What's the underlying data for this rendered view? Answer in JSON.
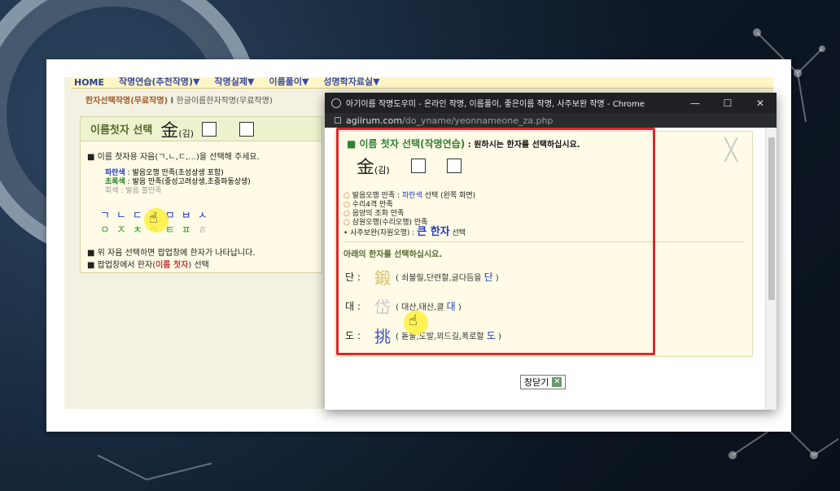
{
  "colors": {
    "accent_red": "#e0262b",
    "green": "#2f7f2f",
    "blue": "#1f3bbf"
  },
  "page": {
    "topnav": [
      "HOME",
      "작명연습(추천작명)▼",
      "작명실제▼",
      "이름풀이▼",
      "성명학자료실▼"
    ],
    "tabs": {
      "t1": "한자선택작명(무료작명)",
      "sep": " l ",
      "t2": "한글이름한자작명(무료작명)"
    },
    "left": {
      "title": "이름첫자 선택",
      "hanja": "金",
      "kim": "(김)",
      "instr": "■ 이름 첫자용 자음(ㄱ,ㄴ,ㄷ,...)을 선택해 주세요.",
      "legend": [
        {
          "c": "파란색",
          "t": " : 발음오행 만족(초성상생 포함)"
        },
        {
          "c": "초록색",
          "t": " : 발음 만족(중성고려상생,초중파동상생)"
        },
        {
          "c": "회색",
          "t": " : 발음 불만족"
        }
      ],
      "row1": "ㄱㄴㄷㄹㅁㅂㅅ",
      "row2_green": "ㅇㅈㅊㅋㅌㅍ",
      "row2_gray": "ㅎ",
      "note1": "■ 위 자음 선택하면 팝업창에 한자가 나타납니다.",
      "note2_a": "■ 팝업창에서 한자(",
      "note2_b": "이름 첫자",
      "note2_c": ") 선택"
    }
  },
  "popup": {
    "window_title": "아기이름 작명도우미 - 온라인 작명, 이름풀이, 좋은이름 작명, 사주보완 작명 - Chrome",
    "controls": [
      "—",
      "☐",
      "✕"
    ],
    "url_host": "agiirum.com",
    "url_path": "/do_yname/yeonnameone_za.php",
    "title_main": "■ 이름 첫자 선택(작명연습)",
    "title_sub": " : 원하시는 한자를 선택하십시요.",
    "name_hanja": "金",
    "name_kim": "(김)",
    "criteria": [
      "발음오행 만족 : ",
      "파란색",
      " 선택 (왼쪽 화면)",
      "수리4격 만족",
      "음양의 조화 만족",
      "삼원오행(수리오행) 만족"
    ],
    "saju": "사주보완(자원오행) : ",
    "saju_big": "큰 한자",
    "saju_end": " 선택",
    "pick_head": "아래의 한자를 선택하십시요.",
    "rows": [
      {
        "read": "단 :",
        "hanja": "鍛",
        "desc": " ( 쇠불릴,단련할,글다듬을 ",
        "sound": "단",
        "close": " )"
      },
      {
        "read": "대 :",
        "hanja": "岱",
        "desc": " ( 대산,태산,클 ",
        "sound": "대",
        "close": " )"
      },
      {
        "read": "도 :",
        "hanja": "挑",
        "desc": " ( 돋울,도발,꾀드길,폭로할 ",
        "sound": "도",
        "close": " )"
      }
    ],
    "close_btn": "창닫기"
  }
}
